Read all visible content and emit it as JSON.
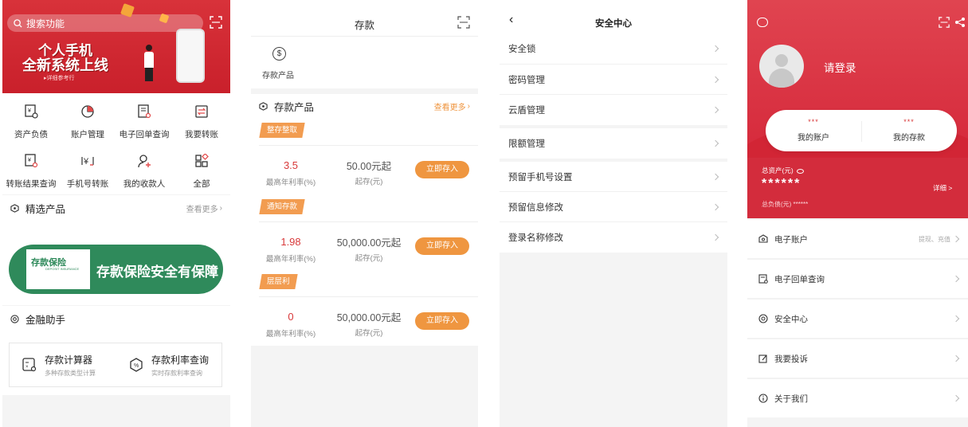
{
  "colors": {
    "brand_red": "#d8323a",
    "accent_orange": "#ef9640",
    "rate_red": "#d8393a",
    "deposit_green": "#2f8a5b",
    "bg_gray": "#f4f4f4"
  },
  "phone1": {
    "search_placeholder": "搜索功能",
    "banner": {
      "line1": "个人手机",
      "line2": "全新系统上线",
      "sub": "▸详细参考行"
    },
    "grid": [
      {
        "label": "资产负债",
        "icon": "asset-report-icon"
      },
      {
        "label": "账户管理",
        "icon": "pie-chart-icon"
      },
      {
        "label": "电子回单查询",
        "icon": "receipt-search-icon"
      },
      {
        "label": "我要转账",
        "icon": "transfer-icon"
      },
      {
        "label": "转账结果查询",
        "icon": "transfer-result-icon"
      },
      {
        "label": "手机号转账",
        "icon": "phone-transfer-icon"
      },
      {
        "label": "我的收款人",
        "icon": "payee-icon"
      },
      {
        "label": "全部",
        "icon": "all-apps-icon"
      }
    ],
    "featured": {
      "title": "精选产品",
      "more": "查看更多"
    },
    "deposit_banner": {
      "logo_text": "存款保险",
      "logo_sub": "DEPOSIT INSURANCE",
      "slogan": "存款保险安全有保障"
    },
    "assistant": {
      "title": "金融助手"
    },
    "tools": [
      {
        "title": "存款计算器",
        "sub": "多种存款类型计算"
      },
      {
        "title": "存款利率查询",
        "sub": "实时存款利率查询"
      }
    ]
  },
  "phone2": {
    "title": "存款",
    "top_product_label": "存款产品",
    "section": {
      "title": "存款产品",
      "more": "查看更多"
    },
    "products": [
      {
        "tag": "整存整取",
        "rate": "3.5",
        "rate_label": "最高年利率(%)",
        "amount": "50.00元起",
        "amount_label": "起存(元)",
        "button": "立即存入"
      },
      {
        "tag": "通知存款",
        "rate": "1.98",
        "rate_label": "最高年利率(%)",
        "amount": "50,000.00元起",
        "amount_label": "起存(元)",
        "button": "立即存入"
      },
      {
        "tag": "层层利",
        "rate": "0",
        "rate_label": "最高年利率(%)",
        "amount": "50,000.00元起",
        "amount_label": "起存(元)",
        "button": "立即存入"
      }
    ]
  },
  "phone3": {
    "title": "安全中心",
    "items": [
      "安全锁",
      "密码管理",
      "云盾管理",
      "限额管理",
      "预留手机号设置",
      "预留信息修改",
      "登录名称修改"
    ]
  },
  "phone4": {
    "login": "请登录",
    "account": {
      "value": "***",
      "label": "我的账户"
    },
    "deposit": {
      "value": "***",
      "label": "我的存款"
    },
    "asset_label": "总资产(元)",
    "asset_value": "******",
    "detail": "详细 >",
    "debt_label": "总负债(元) ******",
    "menu": [
      {
        "label": "电子账户",
        "extra": "提现、充值",
        "icon": "electronic-account-icon"
      },
      {
        "label": "电子回单查询",
        "extra": "",
        "icon": "receipt-icon"
      },
      {
        "label": "安全中心",
        "extra": "",
        "icon": "security-icon"
      },
      {
        "label": "我要投诉",
        "extra": "",
        "icon": "complaint-icon"
      },
      {
        "label": "关于我们",
        "extra": "",
        "icon": "info-icon"
      }
    ]
  }
}
